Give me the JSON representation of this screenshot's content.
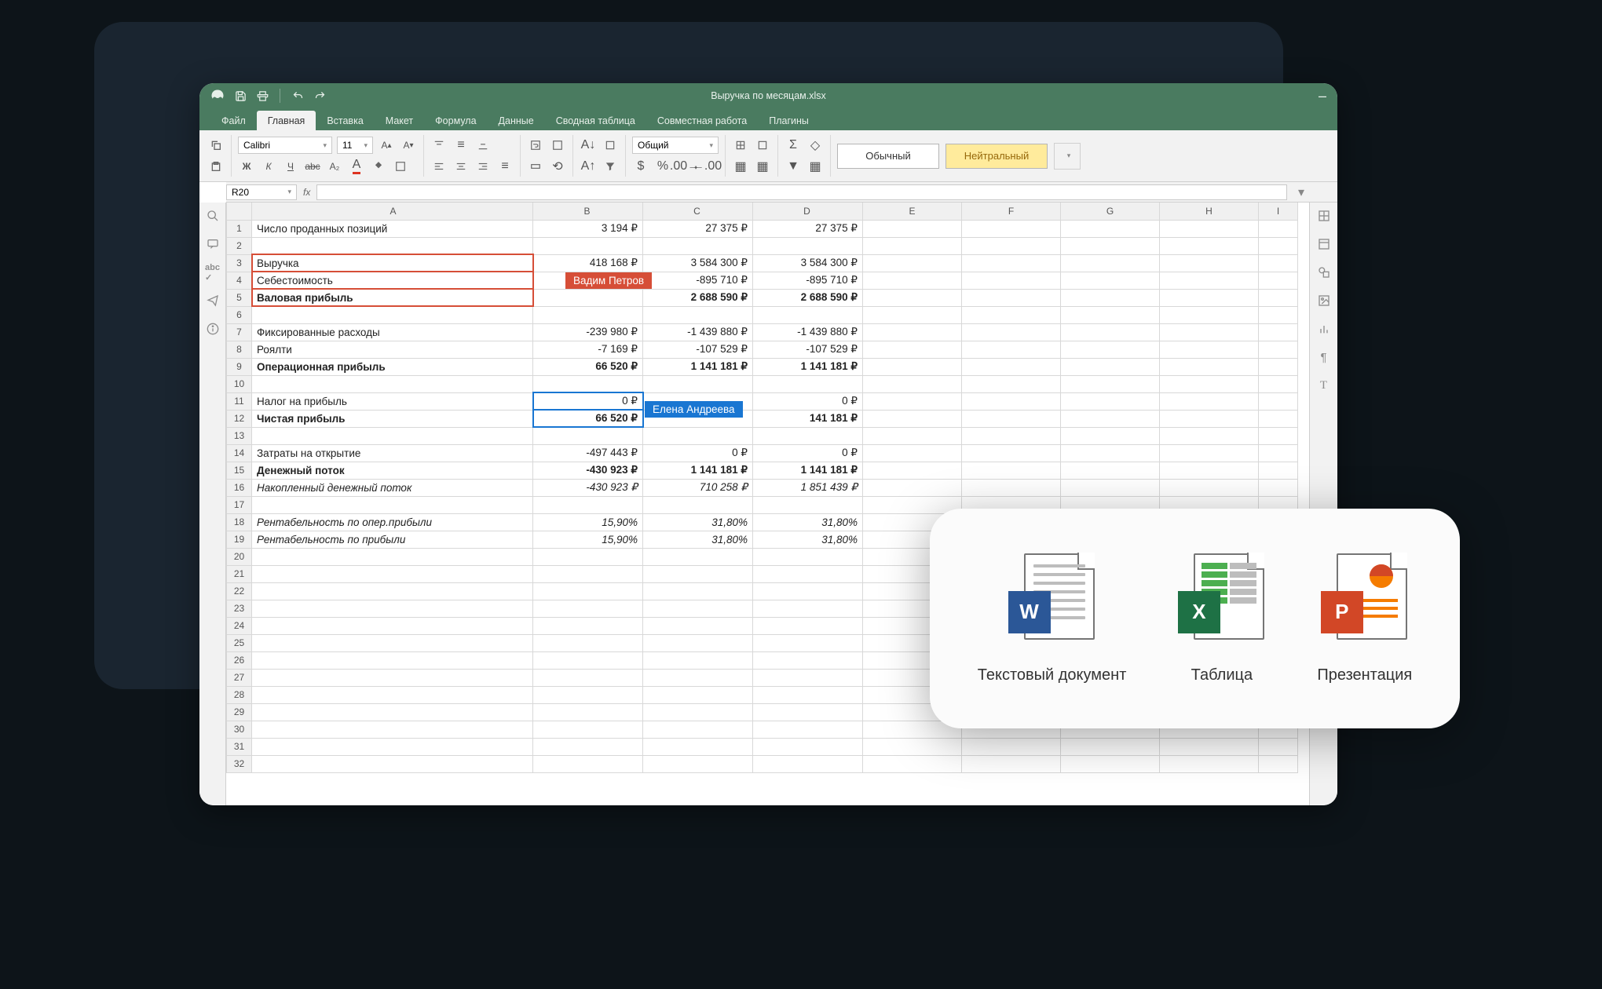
{
  "window": {
    "title": "Выручка по месяцам.xlsx"
  },
  "menu_tabs": [
    "Файл",
    "Главная",
    "Вставка",
    "Макет",
    "Формула",
    "Данные",
    "Сводная таблица",
    "Совместная работа",
    "Плагины"
  ],
  "active_tab_index": 1,
  "ribbon": {
    "font_name": "Calibri",
    "font_size": "11",
    "number_format": "Общий",
    "style_normal": "Обычный",
    "style_neutral": "Нейтральный"
  },
  "formula_bar": {
    "cell_ref": "R20",
    "fx": "fx"
  },
  "columns": [
    "A",
    "B",
    "C",
    "D",
    "E",
    "F",
    "G",
    "H",
    "I"
  ],
  "rows": [
    {
      "n": 1,
      "a": "Число проданных позиций",
      "b": "3 194 ₽",
      "c": "27 375 ₽",
      "d": "27 375 ₽"
    },
    {
      "n": 2
    },
    {
      "n": 3,
      "a": "Выручка",
      "b": "418 168 ₽",
      "c": "3 584 300 ₽",
      "d": "3 584 300 ₽"
    },
    {
      "n": 4,
      "a": "Себестоимость",
      "b": "",
      "c": "-895 710 ₽",
      "d": "-895 710 ₽"
    },
    {
      "n": 5,
      "a": "Валовая прибыль",
      "b": "",
      "c": "2 688 590 ₽",
      "d": "2 688 590 ₽",
      "bold": true
    },
    {
      "n": 6
    },
    {
      "n": 7,
      "a": "Фиксированные расходы",
      "b": "-239 980 ₽",
      "c": "-1 439 880 ₽",
      "d": "-1 439 880 ₽"
    },
    {
      "n": 8,
      "a": "Роялти",
      "b": "-7 169 ₽",
      "c": "-107 529 ₽",
      "d": "-107 529 ₽"
    },
    {
      "n": 9,
      "a": "Операционная прибыль",
      "b": "66 520 ₽",
      "c": "1 141 181 ₽",
      "d": "1 141 181 ₽",
      "bold": true
    },
    {
      "n": 10
    },
    {
      "n": 11,
      "a": "Налог на прибыль",
      "b": "0 ₽",
      "c": "",
      "d": "0 ₽"
    },
    {
      "n": 12,
      "a": "Чистая прибыль",
      "b": "66 520 ₽",
      "c": "",
      "d": "141 181 ₽",
      "bold": true
    },
    {
      "n": 13
    },
    {
      "n": 14,
      "a": "Затраты на открытие",
      "b": "-497 443 ₽",
      "c": "0 ₽",
      "d": "0 ₽"
    },
    {
      "n": 15,
      "a": "Денежный поток",
      "b": "-430 923 ₽",
      "c": "1 141 181 ₽",
      "d": "1 141 181 ₽",
      "bold": true
    },
    {
      "n": 16,
      "a": "Накопленный денежный поток",
      "b": "-430 923 ₽",
      "c": "710 258 ₽",
      "d": "1 851 439 ₽",
      "italic": true
    },
    {
      "n": 17
    },
    {
      "n": 18,
      "a": "Рентабельность по опер.прибыли",
      "b": "15,90%",
      "c": "31,80%",
      "d": "31,80%",
      "italic": true
    },
    {
      "n": 19,
      "a": "Рентабельность по прибыли",
      "b": "15,90%",
      "c": "31,80%",
      "d": "31,80%",
      "italic": true
    },
    {
      "n": 20
    },
    {
      "n": 21
    },
    {
      "n": 22
    },
    {
      "n": 23
    },
    {
      "n": 24
    },
    {
      "n": 25
    },
    {
      "n": 26
    },
    {
      "n": 27
    },
    {
      "n": 28
    },
    {
      "n": 29
    },
    {
      "n": 30
    },
    {
      "n": 31
    },
    {
      "n": 32
    }
  ],
  "collab": {
    "user1": {
      "name": "Вадим Петров",
      "color": "#d64e37"
    },
    "user2": {
      "name": "Елена Андреева",
      "color": "#1976d2"
    }
  },
  "launcher": {
    "doc": "Текстовый документ",
    "sheet": "Таблица",
    "pres": "Презентация"
  }
}
